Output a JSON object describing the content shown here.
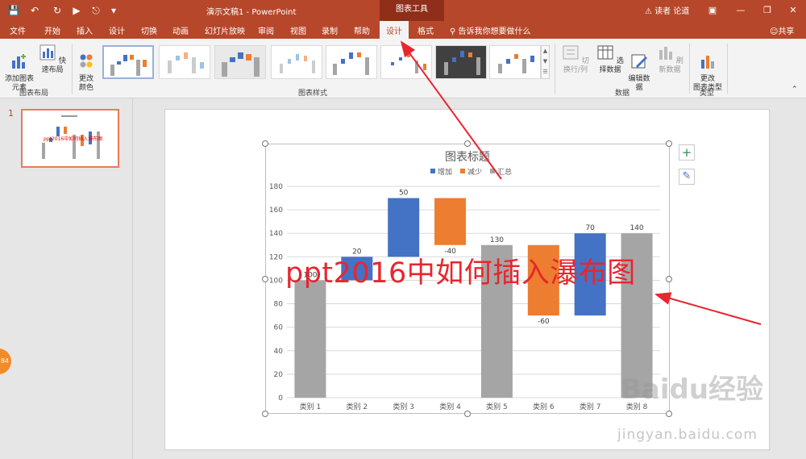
{
  "titlebar": {
    "doc_title": "演示文稿1 - PowerPoint",
    "context_tab": "图表工具",
    "user": "读者 论道",
    "warning_icon": "warning-icon"
  },
  "tabs": {
    "file": "文件",
    "home": "开始",
    "insert": "插入",
    "design": "设计",
    "transitions": "切换",
    "animations": "动画",
    "slideshow": "幻灯片放映",
    "review": "审阅",
    "view": "视图",
    "record": "录制",
    "help": "帮助",
    "chart_design": "设计",
    "chart_format": "格式",
    "tell_me": "告诉我你想要做什么",
    "share": "共享"
  },
  "ribbon": {
    "add_element": "添加图表\n元素",
    "quick_layout": "快速布局",
    "group_layout": "图表布局",
    "change_colors": "更改\n颜色",
    "group_styles": "图表样式",
    "switch_row_col": "切换行/列",
    "select_data": "选择数据",
    "edit_data": "编辑数\n据",
    "refresh_data": "刷新数据",
    "group_data": "数据",
    "change_type": "更改\n图表类型",
    "group_type": "类型"
  },
  "thumbnail": {
    "number": "1"
  },
  "badge": "84",
  "overlay_text": "ppt2016中如何插入瀑布图",
  "watermark": {
    "main": "Baidu经验",
    "sub": "jingyan.baidu.com"
  },
  "colors": {
    "brand": "#b7472a",
    "increase": "#4472c4",
    "decrease": "#ed7d31",
    "total": "#a5a5a5",
    "annotation": "#e8262d"
  },
  "chart_data": {
    "type": "bar",
    "subtype": "waterfall",
    "title": "图表标题",
    "legend": [
      "增加",
      "减少",
      "汇总"
    ],
    "legend_position": "top",
    "categories": [
      "类别 1",
      "类别 2",
      "类别 3",
      "类别 4",
      "类别 5",
      "类别 6",
      "类别 7",
      "类别 8"
    ],
    "deltas": [
      100,
      20,
      50,
      -40,
      130,
      -60,
      70,
      140
    ],
    "kinds": [
      "total",
      "increase",
      "increase",
      "decrease",
      "total",
      "decrease",
      "increase",
      "total"
    ],
    "labels": [
      "100",
      "20",
      "50",
      "-40",
      "130",
      "-60",
      "70",
      "140"
    ],
    "ylim": [
      0,
      180
    ],
    "yticks": [
      0,
      20,
      40,
      60,
      80,
      100,
      120,
      140,
      160,
      180
    ],
    "grid": true
  }
}
